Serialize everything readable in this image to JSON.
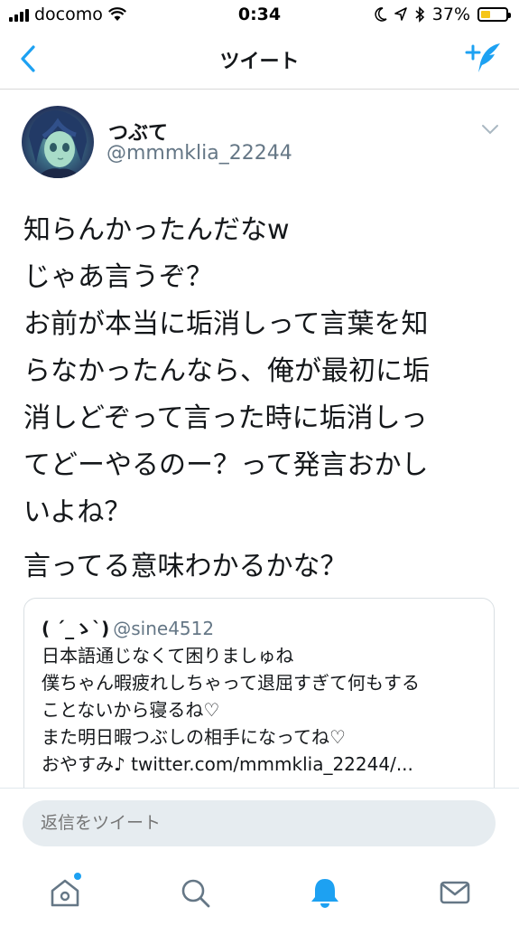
{
  "status_bar": {
    "carrier": "docomo",
    "time": "0:34",
    "battery": "37%",
    "battery_level": 0.37
  },
  "nav": {
    "title": "ツイート"
  },
  "tweet": {
    "author_name": "つぶて",
    "author_handle": "@mmmklia_22244",
    "text_paragraph_1": "知らんかったんだなw\nじゃあ言うぞ？\nお前が本当に垢消しって言葉を知\nらなかったんなら、俺が最初に垢\n消しどぞって言った時に垢消しっ\nてどーやるのー？って発言おかし\nいよね？",
    "text_paragraph_2": "言ってる意味わかるかな？"
  },
  "quote": {
    "name": "( ´_ゝ`)",
    "handle": "@sine4512",
    "lines": [
      "日本語通じなくて困りましゅね",
      "僕ちゃん暇疲れしちゃって退屈すぎて何もする",
      "ことないから寝るね♡",
      "また明日暇つぶしの相手になってね♡",
      "おやすみ♪ twitter.com/mmmklia_22244/..."
    ]
  },
  "reply": {
    "placeholder": "返信をツイート"
  },
  "tabs": {
    "home_icon": "home-icon",
    "search_icon": "search-icon",
    "notifications_icon": "bell-icon",
    "messages_icon": "envelope-icon",
    "active": "notifications"
  },
  "colors": {
    "accent": "#1da1f2",
    "secondary_text": "#657786",
    "battery_fill": "#f5c518"
  }
}
